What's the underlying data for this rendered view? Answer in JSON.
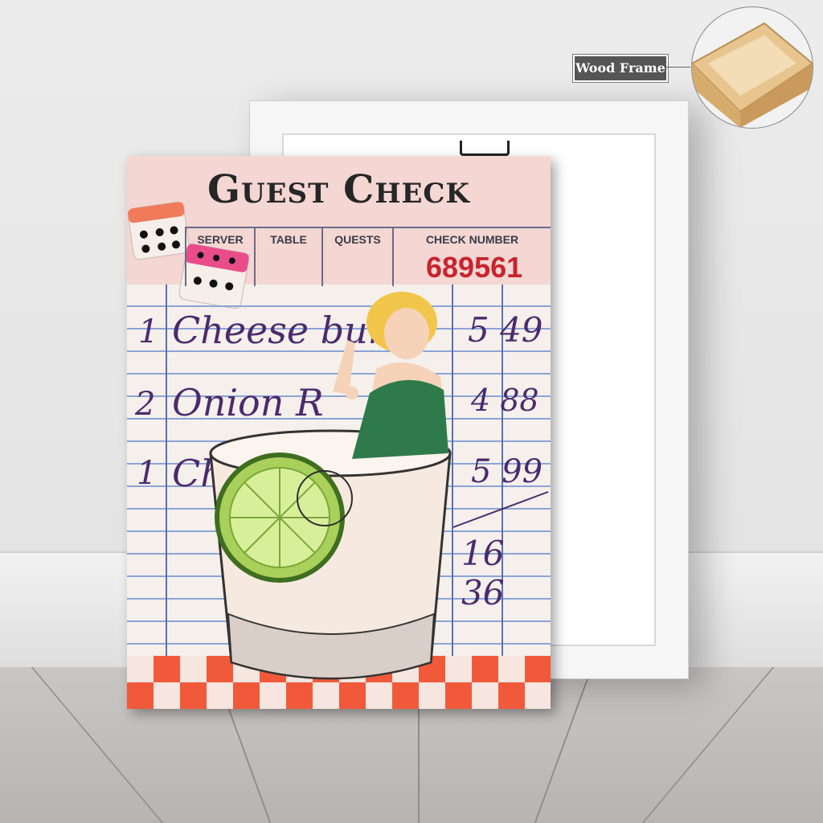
{
  "product": {
    "badge_label": "Wood Frame"
  },
  "artwork": {
    "title": "Guest Check",
    "headers": [
      "SERVER",
      "TABLE",
      "QUESTS",
      "CHECK NUMBER"
    ],
    "check_number": "689561",
    "items": [
      {
        "qty": "1",
        "name": "Cheese burg",
        "price": "5 49"
      },
      {
        "qty": "2",
        "name": "Onion R",
        "price": "4 88"
      },
      {
        "qty": "1",
        "name": "Ch",
        "price": "5 99"
      }
    ],
    "total": "16 36"
  },
  "colors": {
    "accent_red": "#c8242e",
    "checker_orange": "#f05a3a",
    "pink_header": "#f4d6d2"
  }
}
